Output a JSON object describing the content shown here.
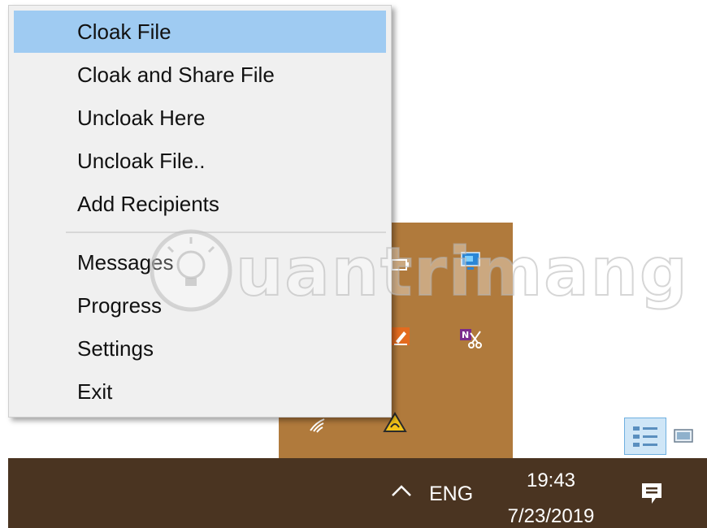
{
  "context_menu": {
    "items": [
      {
        "label": "Cloak File"
      },
      {
        "label": "Cloak and Share File"
      },
      {
        "label": "Uncloak Here"
      },
      {
        "label": "Uncloak File.."
      },
      {
        "label": "Add Recipients"
      },
      {
        "label": "Messages"
      },
      {
        "label": "Progress"
      },
      {
        "label": "Settings"
      },
      {
        "label": "Exit"
      }
    ],
    "highlighted_item": "Cloak File",
    "highlight_color": "#9fcbf2"
  },
  "tray_flyout": {
    "background": "#b07a3c",
    "icons": [
      "battery-icon",
      "remote-desktop-icon",
      "edit-tool-icon",
      "onenote-clipper-icon",
      "wifi-icon",
      "warning-icon"
    ]
  },
  "taskbar": {
    "background": "#4a3421",
    "language": "ENG",
    "time": "19:43",
    "date": "7/23/2019",
    "icons": [
      "chevron-up-icon",
      "action-center-icon"
    ]
  },
  "watermark": {
    "text": "uantrimang"
  }
}
